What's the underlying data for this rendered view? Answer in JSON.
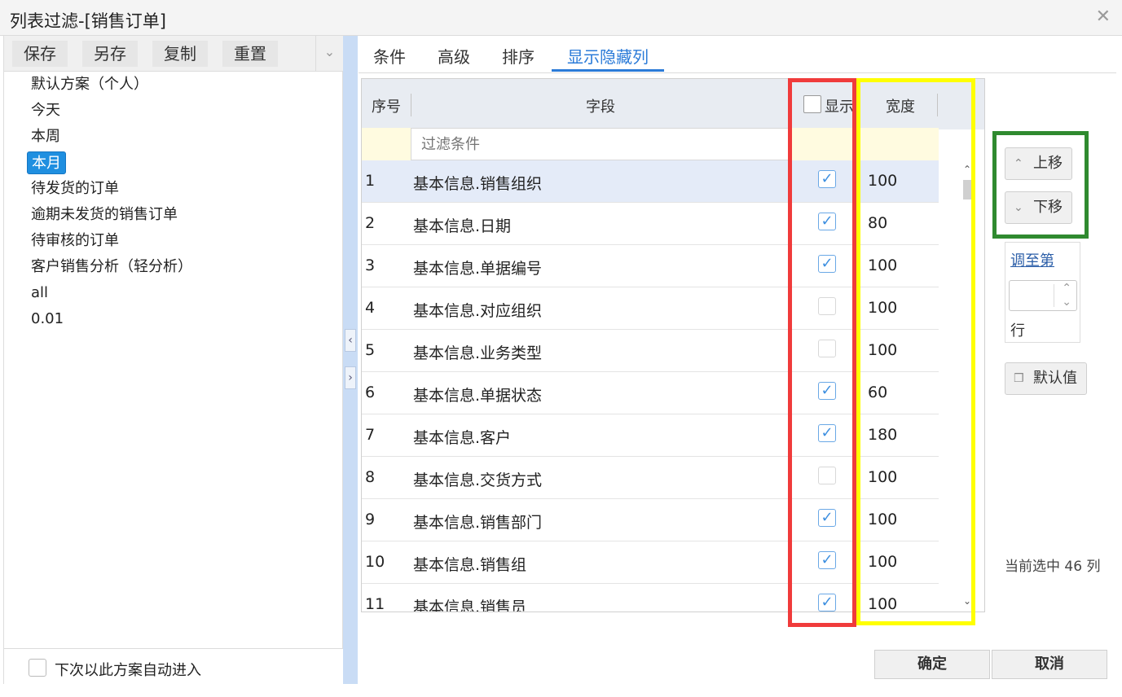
{
  "window": {
    "title": "列表过滤-[销售订单]",
    "close_glyph": "✕"
  },
  "toolbar": {
    "save": "保存",
    "save_as": "另存",
    "copy": "复制",
    "reset": "重置"
  },
  "schemes": [
    "默认方案（个人）",
    "今天",
    "本周",
    "本月",
    "待发货的订单",
    "逾期未发货的销售订单",
    "待审核的订单",
    "客户销售分析（轻分析）",
    "all",
    "0.01"
  ],
  "selected_scheme": "本月",
  "left_footer": {
    "auto_enter_label": "下次以此方案自动进入"
  },
  "tabs": [
    "条件",
    "高级",
    "排序",
    "显示隐藏列"
  ],
  "active_tab": "显示隐藏列",
  "grid": {
    "headers": {
      "index": "序号",
      "field": "字段",
      "show": "显示",
      "width": "宽度"
    },
    "filter_placeholder": "过滤条件",
    "rows": [
      {
        "index": "1",
        "field": "基本信息.销售组织",
        "show": true,
        "width": "100"
      },
      {
        "index": "2",
        "field": "基本信息.日期",
        "show": true,
        "width": "80"
      },
      {
        "index": "3",
        "field": "基本信息.单据编号",
        "show": true,
        "width": "100"
      },
      {
        "index": "4",
        "field": "基本信息.对应组织",
        "show": false,
        "width": "100"
      },
      {
        "index": "5",
        "field": "基本信息.业务类型",
        "show": false,
        "width": "100"
      },
      {
        "index": "6",
        "field": "基本信息.单据状态",
        "show": true,
        "width": "60"
      },
      {
        "index": "7",
        "field": "基本信息.客户",
        "show": true,
        "width": "180"
      },
      {
        "index": "8",
        "field": "基本信息.交货方式",
        "show": false,
        "width": "100"
      },
      {
        "index": "9",
        "field": "基本信息.销售部门",
        "show": true,
        "width": "100"
      },
      {
        "index": "10",
        "field": "基本信息.销售组",
        "show": true,
        "width": "100"
      },
      {
        "index": "11",
        "field": "基本信息.销售员",
        "show": true,
        "width": "100"
      }
    ]
  },
  "side": {
    "move_up": "上移",
    "move_down": "下移",
    "goto_link": "调至第",
    "goto_row": "行",
    "default_value": "默认值",
    "selected_count": "当前选中 46 列"
  },
  "footer": {
    "ok": "确定",
    "cancel": "取消"
  },
  "colors": {
    "accent": "#2b7bd8",
    "highlight_red": "#f03b3b",
    "highlight_yellow": "#ffff00",
    "highlight_green": "#2f8a2f"
  }
}
